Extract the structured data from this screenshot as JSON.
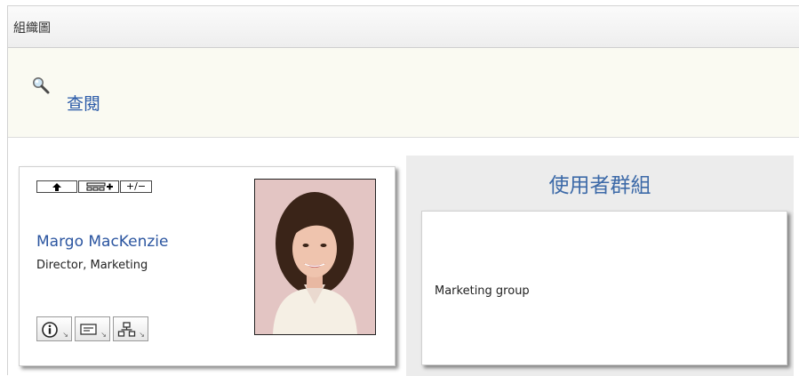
{
  "window": {
    "title": "組織圖"
  },
  "toolbar": {
    "view_label": "查閱",
    "view_icon": "magnifier-icon"
  },
  "person": {
    "name": "Margo MacKenzie",
    "title": "Director, Marketing",
    "nav_buttons": [
      "↑",
      "⊞+",
      "+/−"
    ],
    "action_icons": [
      "info-icon",
      "email-icon",
      "org-chart-icon"
    ]
  },
  "groups": {
    "heading": "使用者群組",
    "items": [
      "Marketing group"
    ]
  },
  "colors": {
    "link": "#2b55a0",
    "heading": "#3d6aa8",
    "toolbar_bg": "#fafaf2"
  }
}
